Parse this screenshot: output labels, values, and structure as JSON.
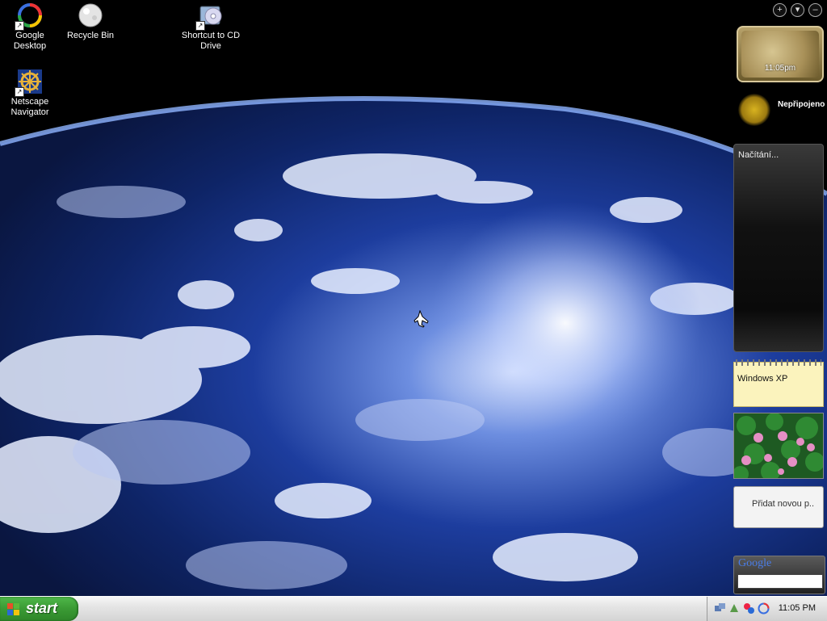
{
  "desktop": {
    "icons": [
      {
        "label": "Google Desktop",
        "icon": "google-desktop-icon"
      },
      {
        "label": "Recycle Bin",
        "icon": "recycle-bin-icon"
      },
      {
        "label": "Shortcut to CD Drive",
        "icon": "cd-drive-icon"
      },
      {
        "label": "Netscape Navigator",
        "icon": "netscape-navigator-icon"
      }
    ]
  },
  "sidebar": {
    "controls": {
      "add": "+",
      "menu": "▾",
      "minimize": "–"
    },
    "clock": {
      "time": "11:05pm"
    },
    "weather": {
      "status": "Nepřipojeno"
    },
    "feed": {
      "status": "Načítání..."
    },
    "notes": {
      "text": "Windows XP"
    },
    "add_gadget": {
      "text": "Přidat novou p.."
    },
    "google_search": {
      "logo": "Google",
      "placeholder": ""
    }
  },
  "taskbar": {
    "start_label": "start",
    "tray_time": "11:05 PM"
  },
  "colors": {
    "start_green": "#3a9a34",
    "taskbar_gray": "#e5e5e5"
  }
}
